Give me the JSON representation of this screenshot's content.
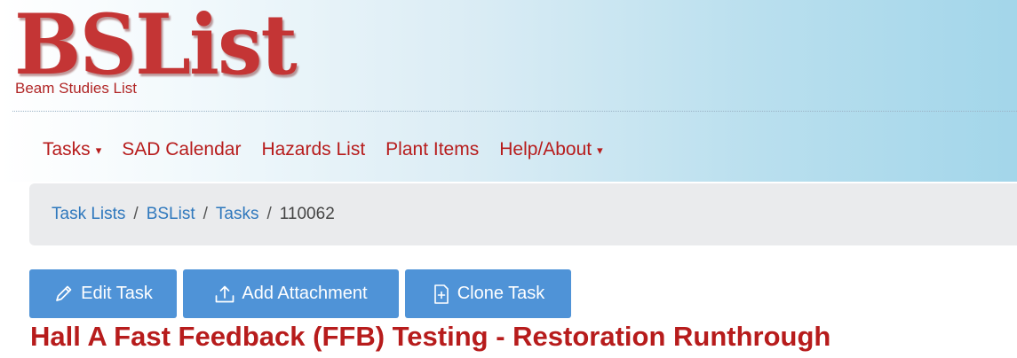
{
  "logo": {
    "title": "BSList",
    "subtitle": "Beam Studies List",
    "color": "#c43535"
  },
  "nav": {
    "items": [
      {
        "label": "Tasks",
        "has_dropdown": true
      },
      {
        "label": "SAD Calendar",
        "has_dropdown": false
      },
      {
        "label": "Hazards List",
        "has_dropdown": false
      },
      {
        "label": "Plant Items",
        "has_dropdown": false
      },
      {
        "label": "Help/About",
        "has_dropdown": true
      }
    ],
    "caret": "▾",
    "color": "#b71c1c"
  },
  "breadcrumb": {
    "links": [
      "Task Lists",
      "BSList",
      "Tasks"
    ],
    "separator": "/",
    "current": "110062",
    "link_color": "#2f78bd"
  },
  "toolbar": {
    "edit_label": "Edit Task",
    "edit_icon": "pencil-icon",
    "attach_label": "Add Attachment",
    "attach_icon": "upload-icon",
    "clone_label": "Clone Task",
    "clone_icon": "clone-file-icon",
    "button_color": "#4f93d7"
  },
  "task": {
    "title": "Hall A Fast Feedback (FFB) Testing - Restoration Runthrough"
  }
}
